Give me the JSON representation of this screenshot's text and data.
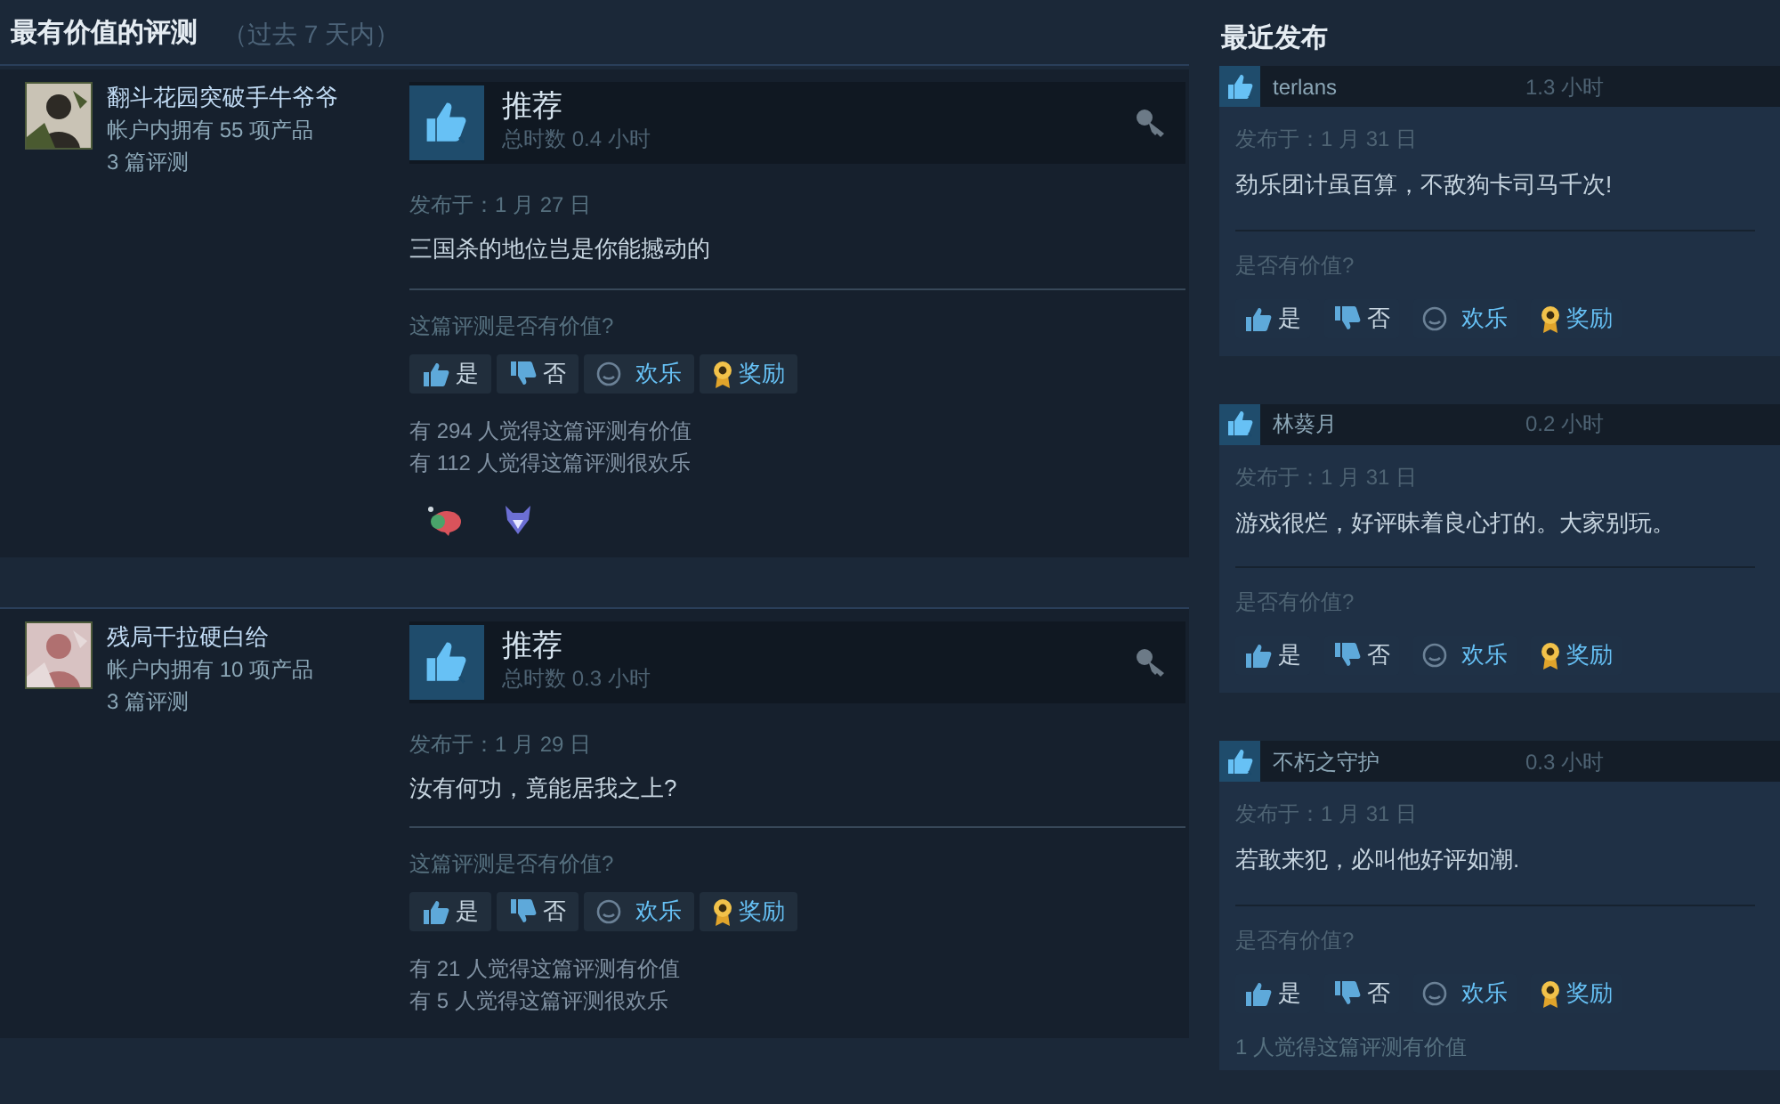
{
  "most_helpful": {
    "title": "最有价值的评测",
    "subtitle": "（过去 7 天内）",
    "reviews": [
      {
        "author": {
          "name": "翻斗花园突破手牛爷爷",
          "products": "帐户内拥有 55 项产品",
          "reviews": "3 篇评测"
        },
        "recommendation": "推荐",
        "hours": "总时数 0.4 小时",
        "posted": "发布于：1 月 27 日",
        "text": "三国杀的地位岂是你能撼动的",
        "question": "这篇评测是否有价值?",
        "vote_buttons": [
          {
            "kind": "yes",
            "label": "是"
          },
          {
            "kind": "no",
            "label": "否"
          },
          {
            "kind": "funny",
            "label": "欢乐"
          },
          {
            "kind": "award",
            "label": "奖励"
          }
        ],
        "tallies": [
          "有 294 人觉得这篇评测有价值",
          "有 112 人觉得这篇评测很欢乐"
        ],
        "awards": [
          {
            "kind": "ribbon"
          },
          {
            "kind": "wolf"
          }
        ]
      },
      {
        "author": {
          "name": "残局干拉硬白给",
          "products": "帐户内拥有 10 项产品",
          "reviews": "3 篇评测"
        },
        "recommendation": "推荐",
        "hours": "总时数 0.3 小时",
        "posted": "发布于：1 月 29 日",
        "text": "汝有何功，竟能居我之上?",
        "question": "这篇评测是否有价值?",
        "vote_buttons": [
          {
            "kind": "yes",
            "label": "是"
          },
          {
            "kind": "no",
            "label": "否"
          },
          {
            "kind": "funny",
            "label": "欢乐"
          },
          {
            "kind": "award",
            "label": "奖励"
          }
        ],
        "tallies": [
          "有 21 人觉得这篇评测有价值",
          "有 5 人觉得这篇评测很欢乐"
        ]
      }
    ]
  },
  "recent": {
    "title": "最近发布",
    "reviews": [
      {
        "name": "terlans",
        "hours": "1.3 小时",
        "posted": "发布于：1 月 31 日",
        "text": "劲乐团计虽百算，不敌狗卡司马千次!",
        "question": "是否有价值?",
        "vote_buttons": [
          {
            "kind": "yes",
            "label": "是"
          },
          {
            "kind": "no",
            "label": "否"
          },
          {
            "kind": "funny",
            "label": "欢乐"
          },
          {
            "kind": "award",
            "label": "奖励"
          }
        ]
      },
      {
        "name": "林葵月",
        "hours": "0.2 小时",
        "posted": "发布于：1 月 31 日",
        "text": "游戏很烂，好评昧着良心打的。大家别玩。",
        "question": "是否有价值?",
        "vote_buttons": [
          {
            "kind": "yes",
            "label": "是"
          },
          {
            "kind": "no",
            "label": "否"
          },
          {
            "kind": "funny",
            "label": "欢乐"
          },
          {
            "kind": "award",
            "label": "奖励"
          }
        ]
      },
      {
        "name": "不朽之守护",
        "hours": "0.3 小时",
        "posted": "发布于：1 月 31 日",
        "text": "若敢来犯，必叫他好评如潮.",
        "question": "是否有价值?",
        "vote_buttons": [
          {
            "kind": "yes",
            "label": "是"
          },
          {
            "kind": "no",
            "label": "否"
          },
          {
            "kind": "funny",
            "label": "欢乐"
          },
          {
            "kind": "award",
            "label": "奖励"
          }
        ],
        "tallies": [
          "1 人觉得这篇评测有价值"
        ]
      }
    ]
  }
}
